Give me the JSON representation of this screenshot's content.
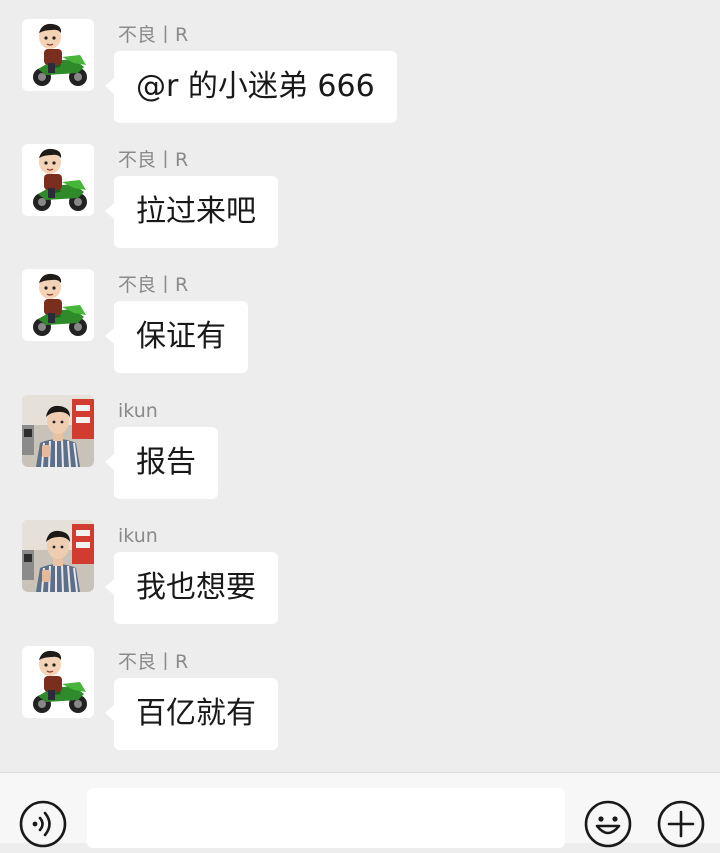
{
  "messages": [
    {
      "sender": "不良丨R",
      "text": "@r 的小迷弟  666",
      "avatar": "cartoon-motorbike-avatar"
    },
    {
      "sender": "不良丨R",
      "text": "拉过来吧",
      "avatar": "cartoon-motorbike-avatar"
    },
    {
      "sender": "不良丨R",
      "text": "保证有",
      "avatar": "cartoon-motorbike-avatar"
    },
    {
      "sender": "ikun",
      "text": "报告",
      "avatar": "photo-person-avatar"
    },
    {
      "sender": "ikun",
      "text": "我也想要",
      "avatar": "photo-person-avatar"
    },
    {
      "sender": "不良丨R",
      "text": "百亿就有",
      "avatar": "cartoon-motorbike-avatar"
    }
  ],
  "input_bar": {
    "text": "",
    "icons": [
      "voice-icon",
      "emoji-icon",
      "plus-icon"
    ]
  },
  "colors": {
    "background": "#ededed",
    "bubble": "#ffffff",
    "sender_name": "#8a8a8a",
    "message_text": "#191919",
    "input_bar": "#f7f7f7"
  }
}
